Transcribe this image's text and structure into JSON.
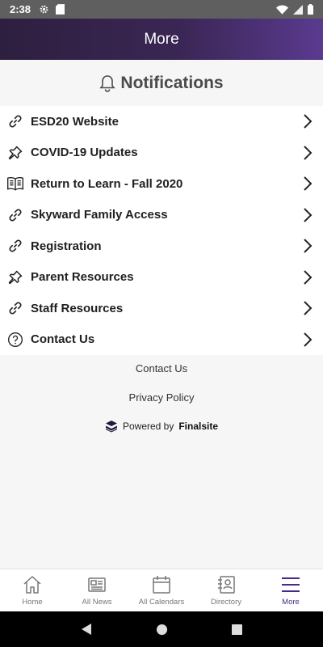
{
  "status_bar": {
    "time": "2:38"
  },
  "header": {
    "title": "More"
  },
  "notifications": {
    "title": "Notifications"
  },
  "menu": {
    "items": [
      {
        "label": "ESD20 Website",
        "icon": "link-icon"
      },
      {
        "label": "COVID-19 Updates",
        "icon": "pin-icon"
      },
      {
        "label": "Return to Learn - Fall 2020",
        "icon": "book-icon"
      },
      {
        "label": "Skyward Family Access",
        "icon": "link-icon"
      },
      {
        "label": "Registration",
        "icon": "link-icon"
      },
      {
        "label": "Parent Resources",
        "icon": "pin-icon"
      },
      {
        "label": "Staff Resources",
        "icon": "link-icon"
      },
      {
        "label": "Contact Us",
        "icon": "help-icon"
      }
    ]
  },
  "footer": {
    "contact_us": "Contact Us",
    "privacy_policy": "Privacy Policy",
    "powered_by": "Powered by",
    "brand": "Finalsite"
  },
  "tabs": {
    "home": "Home",
    "all_news": "All News",
    "all_calendars": "All Calendars",
    "directory": "Directory",
    "more": "More",
    "active": "More"
  },
  "colors": {
    "header_start": "#2d1f3f",
    "header_end": "#5a3a8f",
    "active_tab": "#4a2a86"
  }
}
